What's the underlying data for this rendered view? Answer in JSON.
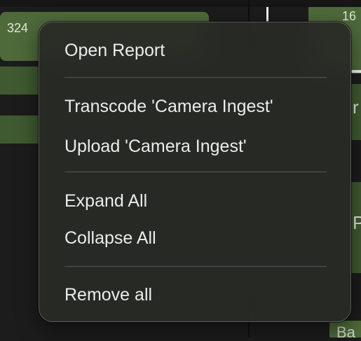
{
  "background": {
    "left_count": "324",
    "right_count": "16",
    "letter_r": "r",
    "letter_p": "P",
    "bottom_fragment": "Ba"
  },
  "menu": {
    "items": [
      {
        "label": "Open Report"
      },
      {
        "label": "Transcode 'Camera Ingest'"
      },
      {
        "label": "Upload 'Camera Ingest'"
      },
      {
        "label": "Expand All"
      },
      {
        "label": "Collapse All"
      },
      {
        "label": "Remove all"
      }
    ]
  },
  "colors": {
    "menu_bg": "#28292a",
    "menu_text": "#ececec",
    "separator": "#575755",
    "track_green": "#4e6a3a"
  }
}
